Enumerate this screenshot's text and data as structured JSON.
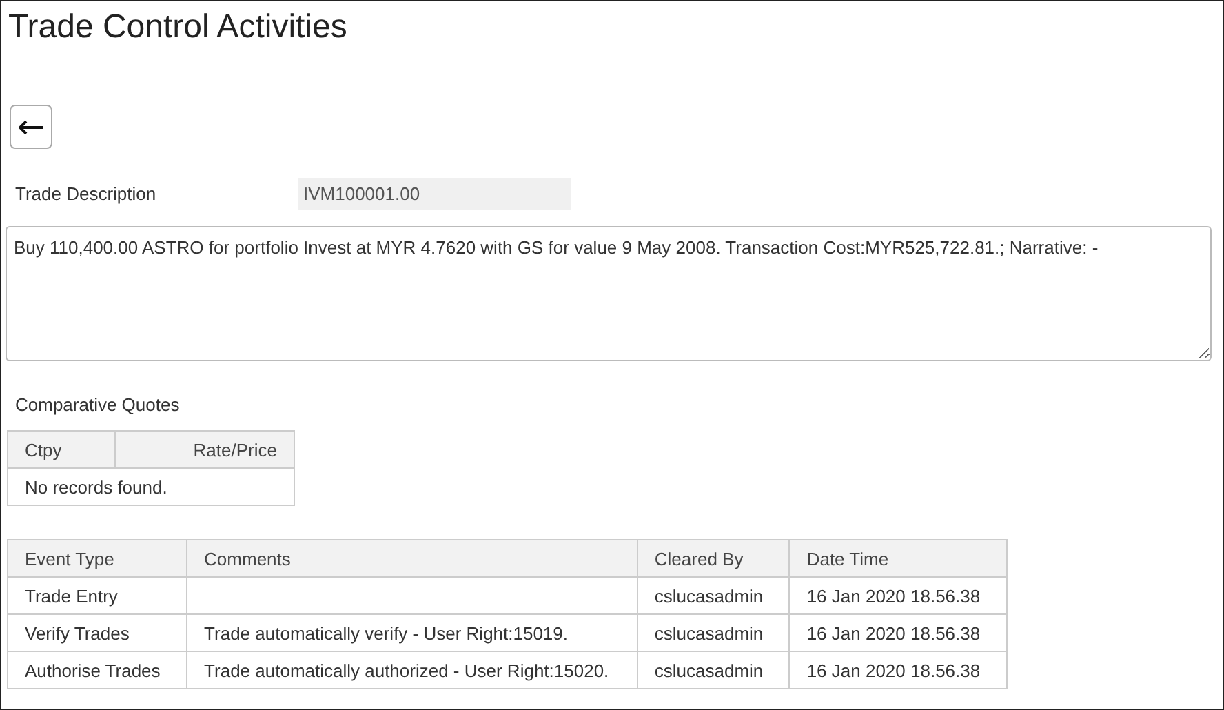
{
  "page": {
    "title": "Trade Control Activities",
    "back_button": "←"
  },
  "trade_description": {
    "label": "Trade Description",
    "value": "IVM100001.00"
  },
  "narrative": {
    "value": "Buy 110,400.00 ASTRO for portfolio Invest at MYR 4.7620 with GS for value 9 May 2008. Transaction Cost:MYR525,722.81.; Narrative: -"
  },
  "comparative_quotes": {
    "title": "Comparative Quotes",
    "columns": [
      "Ctpy",
      "Rate/Price"
    ],
    "empty_message": "No records found."
  },
  "events_table": {
    "columns": [
      "Event Type",
      "Comments",
      "Cleared By",
      "Date Time"
    ],
    "rows": [
      {
        "event_type": "Trade Entry",
        "cleared_by": "cslucasadmin",
        "date_time": "16 Jan 2020 18.56.38"
      },
      {
        "event_type": "Verify Trades",
        "comments": "Trade automatically verify - User Right:15019.",
        "cleared_by": "cslucasadmin",
        "date_time": "16 Jan 2020 18.56.38"
      },
      {
        "event_type": "Authorise Trades",
        "comments": "Trade automatically authorized - User Right:15020.",
        "cleared_by": "cslucasadmin",
        "date_time": "16 Jan 2020 18.56.38"
      }
    ]
  }
}
